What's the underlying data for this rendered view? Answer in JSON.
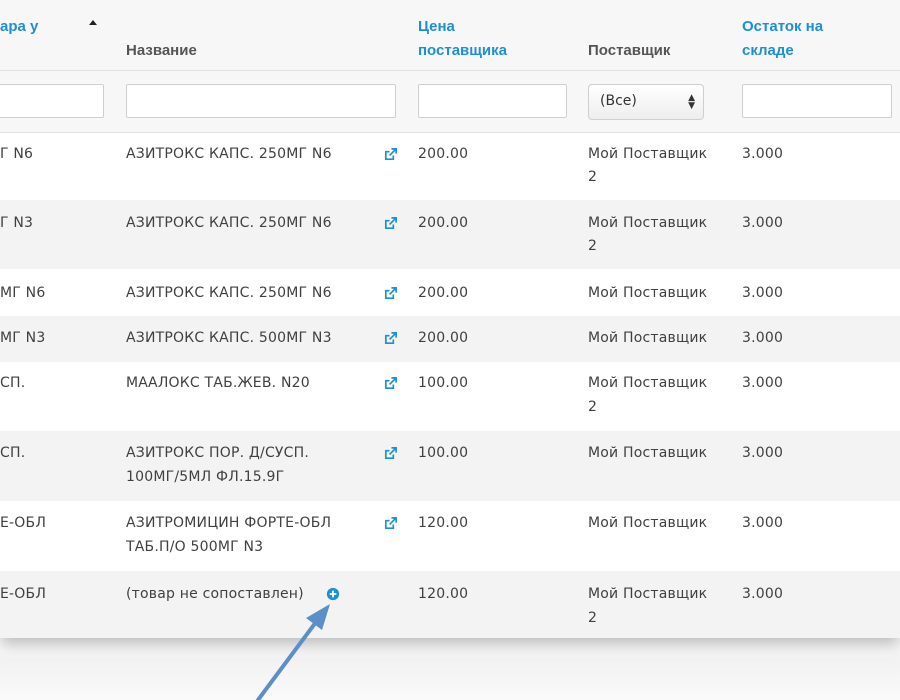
{
  "header": {
    "col_code": "ара у",
    "col_name": "Название",
    "col_price_line1": "Цена",
    "col_price_line2": "поставщика",
    "col_supplier": "Поставщик",
    "col_stock_line1": "Остаток на",
    "col_stock_line2": "складе"
  },
  "filters": {
    "code_value": "",
    "name_value": "",
    "price_value": "",
    "supplier_selected": "(Все)",
    "stock_value": ""
  },
  "rows": [
    {
      "code": "Г N6",
      "name1": "АЗИТРОКС КАПС. 250МГ N6",
      "name2": "",
      "price": "200.00",
      "supplier1": "Мой Поставщик",
      "supplier2": "2",
      "stock": "3.000"
    },
    {
      "code": "Г N3",
      "name1": "АЗИТРОКС КАПС. 250МГ N6",
      "name2": "",
      "price": "200.00",
      "supplier1": "Мой Поставщик",
      "supplier2": "2",
      "stock": "3.000"
    },
    {
      "code": "МГ N6",
      "name1": "АЗИТРОКС КАПС. 250МГ N6",
      "name2": "",
      "price": "200.00",
      "supplier1": "Мой Поставщик",
      "supplier2": "",
      "stock": "3.000"
    },
    {
      "code": "МГ N3",
      "name1": "АЗИТРОКС КАПС. 500МГ N3",
      "name2": "",
      "price": "200.00",
      "supplier1": "Мой Поставщик",
      "supplier2": "",
      "stock": "3.000"
    },
    {
      "code": "СП.",
      "name1": "МААЛОКС ТАБ.ЖЕВ. N20",
      "name2": "",
      "price": "100.00",
      "supplier1": "Мой Поставщик",
      "supplier2": "2",
      "stock": "3.000"
    },
    {
      "code": "СП.",
      "name1": "АЗИТРОКС ПОР. Д/СУСП.",
      "name2": "100МГ/5МЛ ФЛ.15.9Г",
      "price": "100.00",
      "supplier1": "Мой Поставщик",
      "supplier2": "",
      "stock": "3.000"
    },
    {
      "code": "Е-ОБЛ",
      "name1": "АЗИТРОМИЦИН ФОРТЕ-ОБЛ",
      "name2": "ТАБ.П/О 500МГ N3",
      "price": "120.00",
      "supplier1": "Мой Поставщик",
      "supplier2": "",
      "stock": "3.000"
    },
    {
      "code": "Е-ОБЛ",
      "name1": "(товар не сопоставлен)",
      "name2": "",
      "price": "120.00",
      "supplier1": "Мой Поставщик",
      "supplier2": "2",
      "stock": "3.000"
    }
  ],
  "colors": {
    "link": "#1d8fd6",
    "arrow": "#5b8fc7",
    "row_alt": "#f3f3f3"
  },
  "icons": {
    "external": "external-link-icon",
    "add": "plus-circle-icon",
    "sort": "sort-ascending-icon"
  }
}
